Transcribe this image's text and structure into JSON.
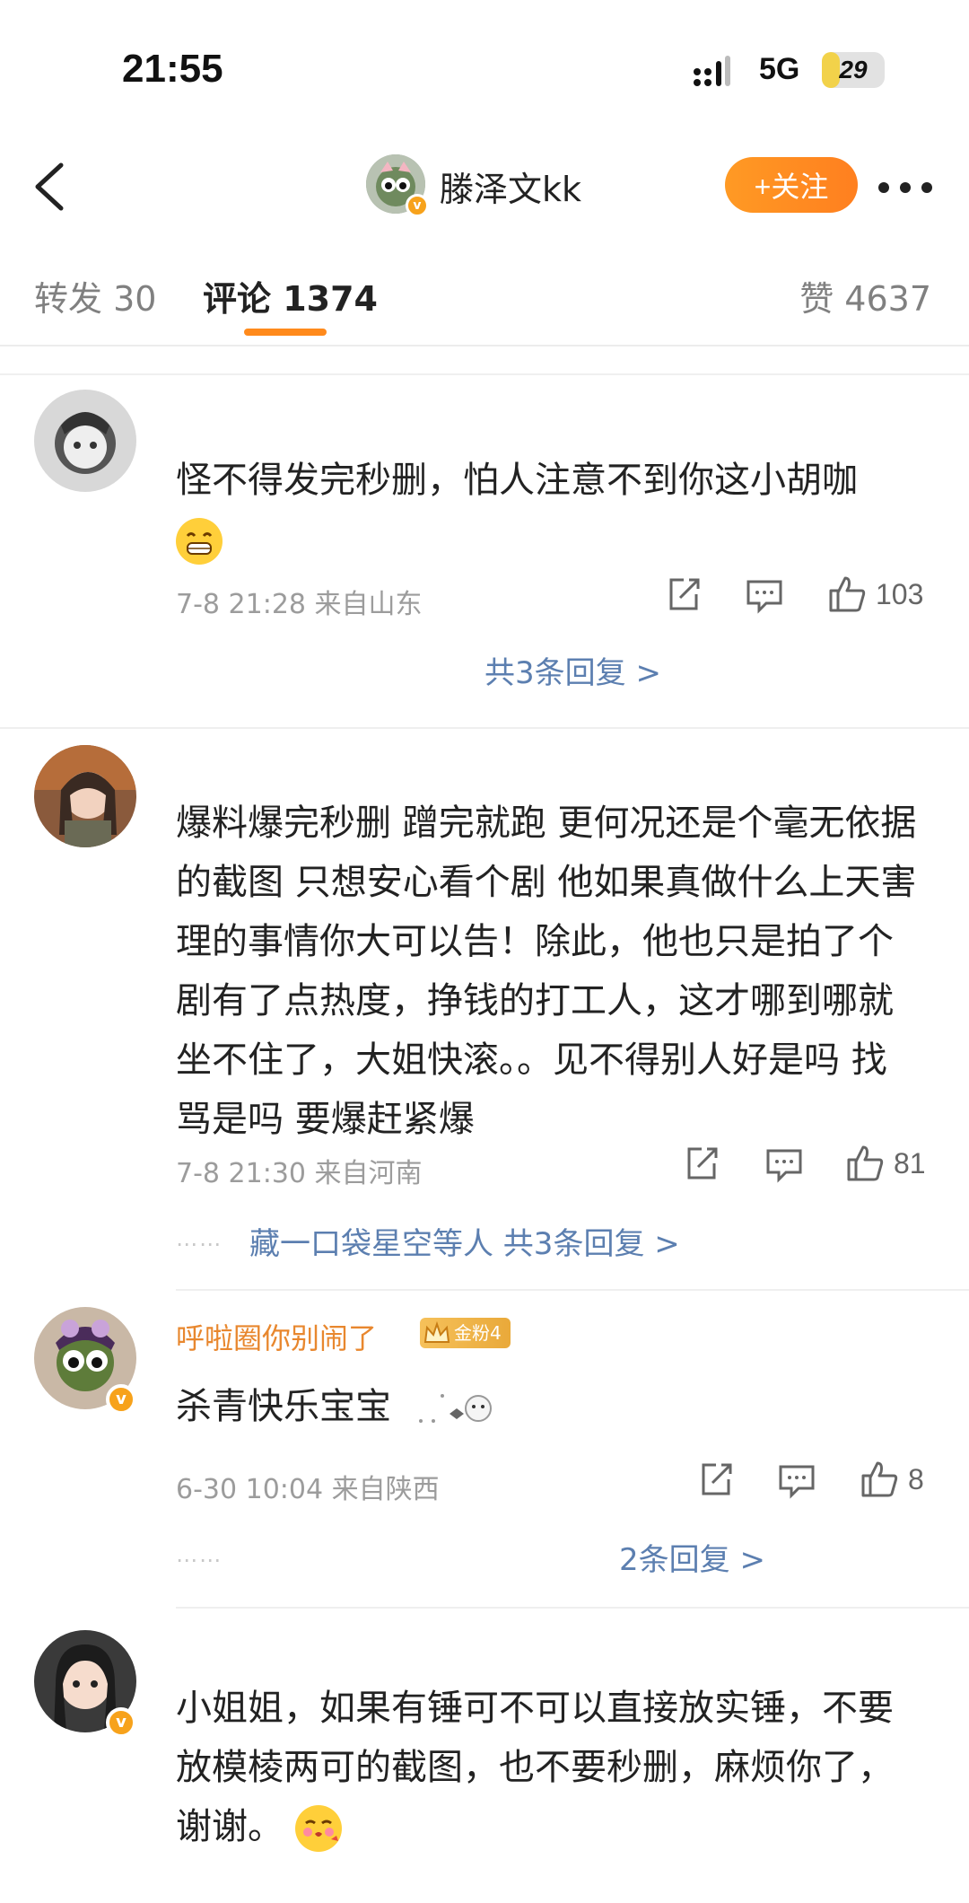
{
  "status_bar": {
    "time": "21:55",
    "network": "5G",
    "battery": "29",
    "battery_level_percent": 29
  },
  "header": {
    "name": "滕泽文kk",
    "follow_label": "+关注"
  },
  "tabs": {
    "repost": "转发 30",
    "comments": "评论 1374",
    "likes": "赞 4637"
  },
  "comments": [
    {
      "text": "怪不得发完秒删，怕人注意不到你这小胡咖",
      "meta": "7-8 21:28 来自山东",
      "likes": "103",
      "replies": "共3条回复 >"
    },
    {
      "text": "爆料爆完秒删 蹭完就跑 更何况还是个毫无依据的截图 只想安心看个剧 他如果真做什么上天害理的事情你大可以告！除此，他也只是拍了个剧有了点热度，挣钱的打工人，这才哪到哪就坐不住了，大姐快滚。。见不得别人好是吗 找骂是吗 要爆赶紧爆",
      "meta": "7-8 21:30 来自河南",
      "likes": "81",
      "replies": "藏一口袋星空等人 共3条回复 >"
    },
    {
      "name": "呼啦圈你别闹了",
      "fan_badge": "金粉4",
      "text": "杀青快乐宝宝",
      "meta": "6-30 10:04 来自陕西",
      "likes": "8",
      "replies": "2条回复 >"
    },
    {
      "text": "小姐姐，如果有锤可不可以直接放实锤，不要放模棱两可的截图，也不要秒删，麻烦你了，谢谢。"
    }
  ],
  "colors": {
    "accent": "#ff8a1c",
    "link": "#5c7fb0",
    "name_orange": "#e8872e",
    "verified": "#f7a21b"
  }
}
